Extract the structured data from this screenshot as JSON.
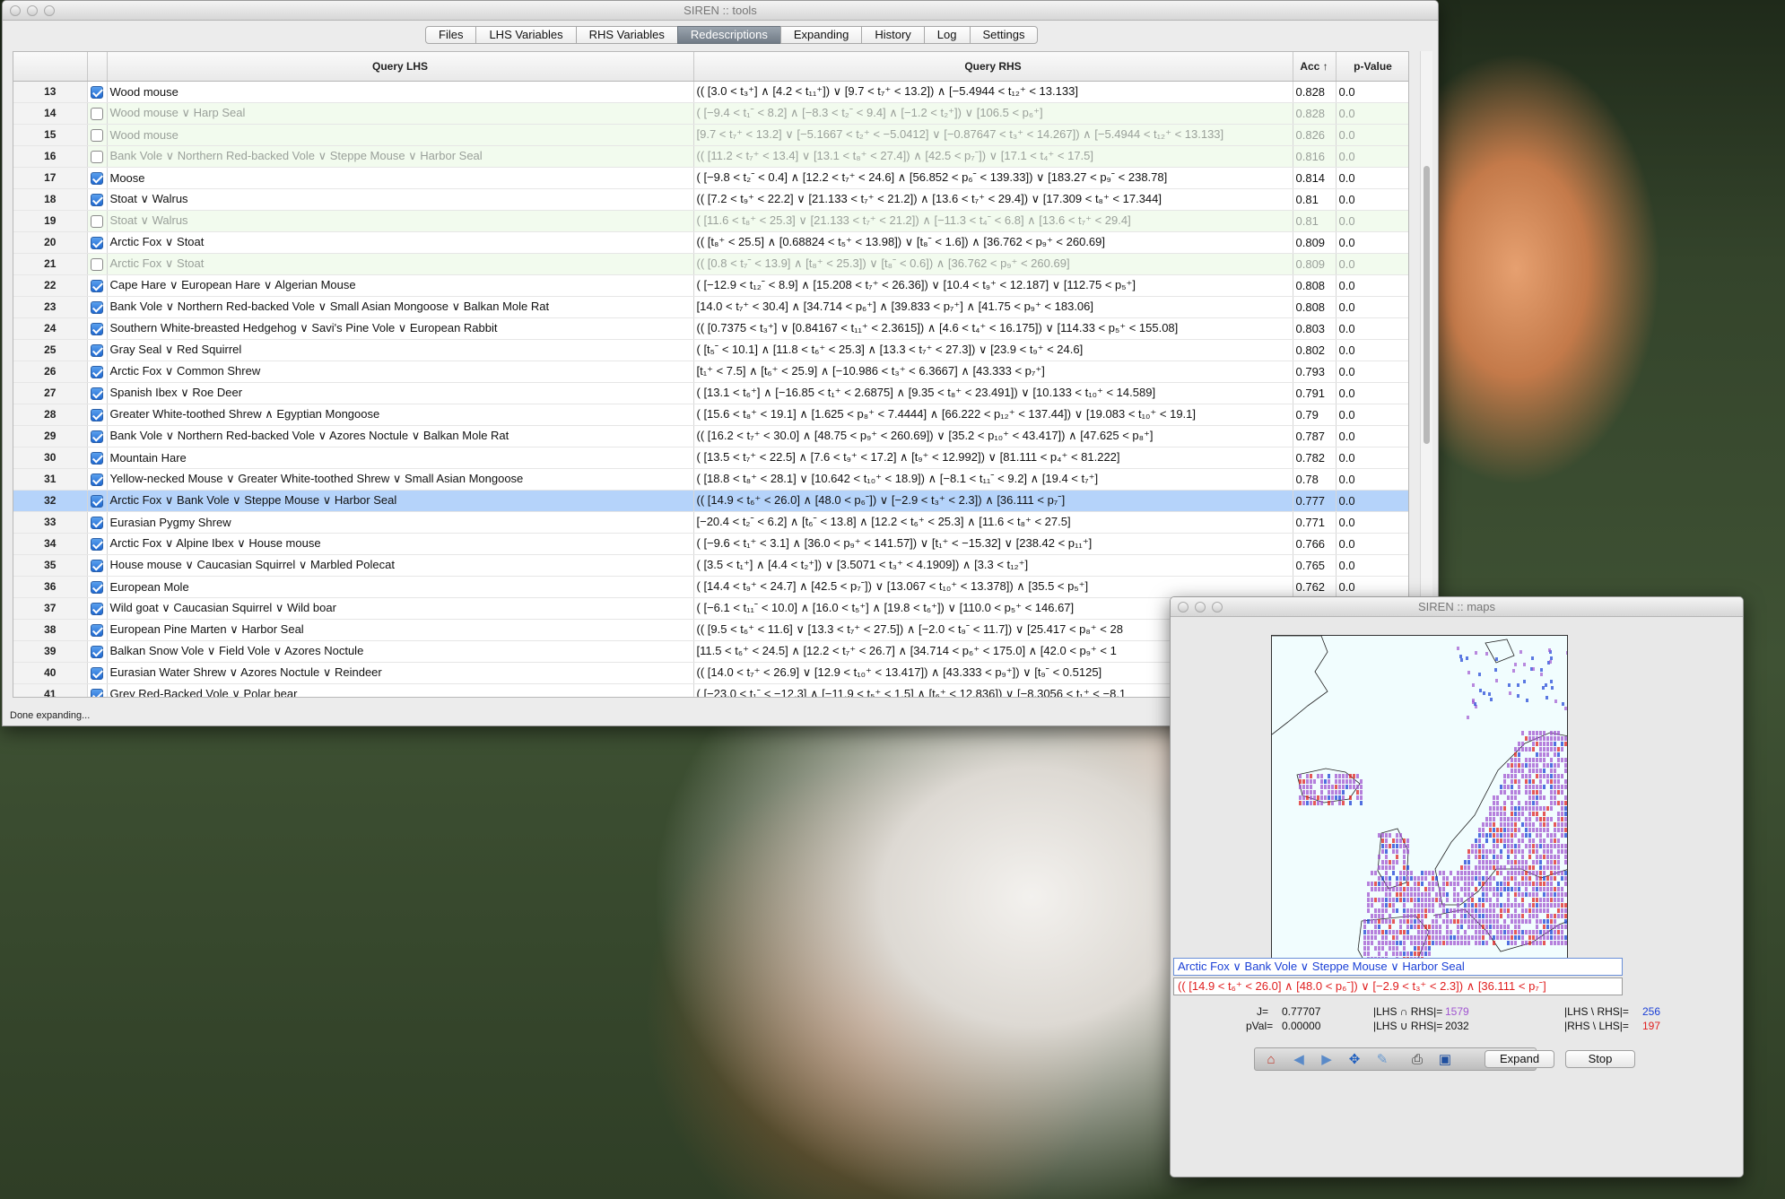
{
  "tools_window": {
    "title": "SIREN :: tools",
    "tabs": [
      {
        "label": "Files"
      },
      {
        "label": "LHS Variables"
      },
      {
        "label": "RHS Variables"
      },
      {
        "label": "Redescriptions",
        "selected": true
      },
      {
        "label": "Expanding"
      },
      {
        "label": "History"
      },
      {
        "label": "Log"
      },
      {
        "label": "Settings"
      }
    ],
    "columns": {
      "num": "",
      "check": "",
      "lhs": "Query LHS",
      "rhs": "Query RHS",
      "acc": "Acc ↑",
      "pval": "p-Value"
    },
    "rows": [
      {
        "n": "13",
        "on": true,
        "lhs": "Wood mouse",
        "rhs": "(( [3.0 < t₃⁺] ∧ [4.2 < t₁₁⁺]) ∨ [9.7 < t₇⁺ < 13.2]) ∧ [−5.4944 < t₁₂⁺ < 13.133]",
        "acc": "0.828",
        "p": "0.0"
      },
      {
        "n": "14",
        "on": false,
        "lhs": "Wood mouse ∨ Harp Seal",
        "rhs": "( [−9.4 < t₁ˉ < 8.2] ∧ [−8.3 < t₂ˉ < 9.4] ∧ [−1.2 < t₂⁺]) ∨ [106.5 < p₆⁺]",
        "acc": "0.828",
        "p": "0.0"
      },
      {
        "n": "15",
        "on": false,
        "lhs": "Wood mouse",
        "rhs": "[9.7 < t₇⁺ < 13.2] ∨ [−5.1667 < t₂⁺ < −5.0412] ∨ [−0.87647 < t₃⁺ < 14.267]) ∧ [−5.4944 < t₁₂⁺ < 13.133]",
        "acc": "0.826",
        "p": "0.0"
      },
      {
        "n": "16",
        "on": false,
        "lhs": "Bank Vole ∨ Northern Red-backed Vole ∨ Steppe Mouse ∨ Harbor Seal",
        "rhs": "(( [11.2 < t₇⁺ < 13.4] ∨ [13.1 < t₈⁺ < 27.4]) ∧ [42.5 < p₇ˉ]) ∨ [17.1 < t₄⁺ < 17.5]",
        "acc": "0.816",
        "p": "0.0"
      },
      {
        "n": "17",
        "on": true,
        "lhs": "Moose",
        "rhs": "( [−9.8 < t₂ˉ < 0.4] ∧ [12.2 < t₇⁺ < 24.6] ∧ [56.852 < p₆ˉ < 139.33]) ∨ [183.27 < p₉ˉ < 238.78]",
        "acc": "0.814",
        "p": "0.0"
      },
      {
        "n": "18",
        "on": true,
        "lhs": "Stoat ∨ Walrus",
        "rhs": "(( [7.2 < t₉⁺ < 22.2] ∨ [21.133 < t₇⁺ < 21.2]) ∧ [13.6 < t₇⁺ < 29.4]) ∨ [17.309 < t₈⁺ < 17.344]",
        "acc": "0.81",
        "p": "0.0"
      },
      {
        "n": "19",
        "on": false,
        "lhs": "Stoat ∨ Walrus",
        "rhs": "( [11.6 < t₈⁺ < 25.3] ∨ [21.133 < t₇⁺ < 21.2]) ∧ [−11.3 < t₄ˉ < 6.8] ∧ [13.6 < t₇⁺ < 29.4]",
        "acc": "0.81",
        "p": "0.0"
      },
      {
        "n": "20",
        "on": true,
        "lhs": "Arctic Fox ∨ Stoat",
        "rhs": "(( [t₈⁺ < 25.5] ∧ [0.68824 < t₅⁺ < 13.98]) ∨ [t₈ˉ < 1.6]) ∧ [36.762 < p₉⁺ < 260.69]",
        "acc": "0.809",
        "p": "0.0"
      },
      {
        "n": "21",
        "on": false,
        "lhs": "Arctic Fox ∨ Stoat",
        "rhs": "(( [0.8 < t₇ˉ < 13.9] ∧ [t₈⁺ < 25.3]) ∨ [t₈ˉ < 0.6]) ∧ [36.762 < p₉⁺ < 260.69]",
        "acc": "0.809",
        "p": "0.0"
      },
      {
        "n": "22",
        "on": true,
        "lhs": "Cape Hare ∨ European Hare ∨ Algerian Mouse",
        "rhs": "( [−12.9 < t₁₂ˉ < 8.9] ∧ [15.208 < t₇⁺ < 26.36]) ∨ [10.4 < t₉⁺ < 12.187] ∨ [112.75 < p₅⁺]",
        "acc": "0.808",
        "p": "0.0"
      },
      {
        "n": "23",
        "on": true,
        "lhs": "Bank Vole ∨ Northern Red-backed Vole ∨ Small Asian Mongoose ∨ Balkan Mole Rat",
        "rhs": "[14.0 < t₇⁺ < 30.4] ∧ [34.714 < p₆⁺] ∧ [39.833 < p₇⁺] ∧ [41.75 < p₉⁺ < 183.06]",
        "acc": "0.808",
        "p": "0.0"
      },
      {
        "n": "24",
        "on": true,
        "lhs": "Southern White-breasted Hedgehog ∨ Savi's Pine Vole ∨ European Rabbit",
        "rhs": "(( [0.7375 < t₃⁺] ∨ [0.84167 < t₁₁⁺ < 2.3615]) ∧ [4.6 < t₄⁺ < 16.175]) ∨ [114.33 < p₅⁺ < 155.08]",
        "acc": "0.803",
        "p": "0.0"
      },
      {
        "n": "25",
        "on": true,
        "lhs": "Gray Seal ∨ Red Squirrel",
        "rhs": "( [t₅ˉ < 10.1] ∧ [11.8 < t₆⁺ < 25.3] ∧ [13.3 < t₇⁺ < 27.3]) ∨ [23.9 < t₉⁺ < 24.6]",
        "acc": "0.802",
        "p": "0.0"
      },
      {
        "n": "26",
        "on": true,
        "lhs": "Arctic Fox ∨ Common Shrew",
        "rhs": "[t₁⁺ < 7.5] ∧ [t₆⁺ < 25.9] ∧ [−10.986 < t₃⁺ < 6.3667] ∧ [43.333 < p₇⁺]",
        "acc": "0.793",
        "p": "0.0"
      },
      {
        "n": "27",
        "on": true,
        "lhs": "Spanish Ibex ∨ Roe Deer",
        "rhs": "( [13.1 < t₆⁺] ∧ [−16.85 < t₁⁺ < 2.6875] ∧ [9.35 < t₈⁺ < 23.491]) ∨ [10.133 < t₁₀⁺ < 14.589]",
        "acc": "0.791",
        "p": "0.0"
      },
      {
        "n": "28",
        "on": true,
        "lhs": "Greater White-toothed Shrew ∧ Egyptian Mongoose",
        "rhs": "( [15.6 < t₈⁺ < 19.1] ∧ [1.625 < p₈⁺ < 7.4444] ∧ [66.222 < p₁₂⁺ < 137.44]) ∨ [19.083 < t₁₀⁺ < 19.1]",
        "acc": "0.79",
        "p": "0.0"
      },
      {
        "n": "29",
        "on": true,
        "lhs": "Bank Vole ∨ Northern Red-backed Vole ∨ Azores Noctule ∨ Balkan Mole Rat",
        "rhs": "(( [16.2 < t₇⁺ < 30.0] ∧ [48.75 < p₉⁺ < 260.69]) ∨ [35.2 < p₁₀⁺ < 43.417]) ∧ [47.625 < p₈⁺]",
        "acc": "0.787",
        "p": "0.0"
      },
      {
        "n": "30",
        "on": true,
        "lhs": "Mountain Hare",
        "rhs": "( [13.5 < t₇⁺ < 22.5] ∧ [7.6 < t₉⁺ < 17.2] ∧ [t₉⁺ < 12.992]) ∨ [81.111 < p₄⁺ < 81.222]",
        "acc": "0.782",
        "p": "0.0"
      },
      {
        "n": "31",
        "on": true,
        "lhs": "Yellow-necked Mouse ∨ Greater White-toothed Shrew ∨ Small Asian Mongoose",
        "rhs": "( [18.8 < t₈⁺ < 28.1] ∨ [10.642 < t₁₀⁺ < 18.9]) ∧ [−8.1 < t₁₁ˉ < 9.2] ∧ [19.4 < t₇⁺]",
        "acc": "0.78",
        "p": "0.0"
      },
      {
        "n": "32",
        "on": true,
        "sel": true,
        "lhs": "Arctic Fox ∨ Bank Vole ∨ Steppe Mouse ∨ Harbor Seal",
        "rhs": "(( [14.9 < t₆⁺ < 26.0] ∧ [48.0 < p₆ˉ]) ∨ [−2.9 < t₃⁺ < 2.3]) ∧ [36.111 < p₇ˉ]",
        "acc": "0.777",
        "p": "0.0"
      },
      {
        "n": "33",
        "on": true,
        "lhs": "Eurasian Pygmy Shrew",
        "rhs": "[−20.4 < t₂ˉ < 6.2] ∧ [t₆ˉ < 13.8] ∧ [12.2 < t₆⁺ < 25.3] ∧ [11.6 < t₈⁺ < 27.5]",
        "acc": "0.771",
        "p": "0.0"
      },
      {
        "n": "34",
        "on": true,
        "lhs": "Arctic Fox ∨ Alpine Ibex ∨ House mouse",
        "rhs": "( [−9.6 < t₁⁺ < 3.1] ∧ [36.0 < p₉⁺ < 141.57]) ∨ [t₁⁺ < −15.32] ∨ [238.42 < p₁₁⁺]",
        "acc": "0.766",
        "p": "0.0"
      },
      {
        "n": "35",
        "on": true,
        "lhs": "House mouse ∨ Caucasian Squirrel ∨ Marbled Polecat",
        "rhs": "( [3.5 < t₁⁺] ∧ [4.4 < t₂⁺]) ∨ [3.5071 < t₃⁺ < 4.1909]) ∧ [3.3 < t₁₂⁺]",
        "acc": "0.765",
        "p": "0.0"
      },
      {
        "n": "36",
        "on": true,
        "lhs": "European Mole",
        "rhs": "( [14.4 < t₉⁺ < 24.7] ∧ [42.5 < p₇ˉ]) ∨ [13.067 < t₁₀⁺ < 13.378]) ∧ [35.5 < p₅⁺]",
        "acc": "0.762",
        "p": "0.0"
      },
      {
        "n": "37",
        "on": true,
        "lhs": "Wild goat ∨ Caucasian Squirrel ∨ Wild boar",
        "rhs": "( [−6.1 < t₁₁ˉ < 10.0] ∧ [16.0 < t₅⁺] ∧ [19.8 < t₆⁺]) ∨ [110.0 < p₅⁺ < 146.67]",
        "acc": "0.762",
        "p": "0.0"
      },
      {
        "n": "38",
        "on": true,
        "lhs": "European Pine Marten ∨ Harbor Seal",
        "rhs": "(( [9.5 < t₆⁺ < 11.6] ∨ [13.3 < t₇⁺ < 27.5]) ∧ [−2.0 < t₉ˉ < 11.7]) ∨ [25.417 < p₈⁺ < 28",
        "acc": "",
        "p": ""
      },
      {
        "n": "39",
        "on": true,
        "lhs": "Balkan Snow Vole ∨ Field Vole ∨ Azores Noctule",
        "rhs": "[11.5 < t₆⁺ < 24.5] ∧ [12.2 < t₇⁺ < 26.7] ∧ [34.714 < p₆⁺ < 175.0] ∧ [42.0 < p₉⁺ < 1",
        "acc": "",
        "p": ""
      },
      {
        "n": "40",
        "on": true,
        "lhs": "Eurasian Water Shrew ∨ Azores Noctule ∨ Reindeer",
        "rhs": "(( [14.0 < t₇⁺ < 26.9] ∨ [12.9 < t₁₀⁺ < 13.417]) ∧ [43.333 < p₉⁺]) ∨ [t₉ˉ < 0.5125]",
        "acc": "",
        "p": ""
      },
      {
        "n": "41",
        "on": true,
        "lhs": "Grey Red-Backed Vole ∨ Polar bear",
        "rhs": "( [−23.0 < t₁ˉ < −12.3] ∧ [−11.9 < t₅⁺ < 1.5] ∧ [t₆⁺ < 12.836]) ∨ [−8.3056 < t₁⁺ < −8.1",
        "acc": "",
        "p": ""
      }
    ],
    "status": "Done expanding..."
  },
  "maps_window": {
    "title": "SIREN :: maps",
    "lhs_query": "Arctic Fox ∨ Bank Vole ∨ Steppe Mouse ∨ Harbor Seal",
    "rhs_query": "(( [14.9 < t₆⁺ < 26.0] ∧ [48.0 < p₆ˉ]) ∨ [−2.9 < t₃⁺ < 2.3]) ∧ [36.111 < p₇ˉ]",
    "stats": {
      "j_label": "J=",
      "j_value": "0.77707",
      "pval_label": "pVal=",
      "pval_value": "0.00000",
      "inter_label": "|LHS ∩ RHS|=",
      "inter_value": "1579",
      "union_label": "|LHS ∪ RHS|=",
      "union_value": "2032",
      "lhs_only_label": "|LHS \\ RHS|=",
      "lhs_only_value": "256",
      "rhs_only_label": "|RHS \\ LHS|=",
      "rhs_only_value": "197"
    },
    "toolbar_icons": [
      "home-icon",
      "back-icon",
      "forward-icon",
      "pan-icon",
      "configure-icon",
      "print-icon",
      "save-icon"
    ],
    "buttons": {
      "expand": "Expand",
      "stop": "Stop"
    },
    "colors": {
      "lhs": "#1a3fd6",
      "rhs": "#e02020",
      "both": "#a055d0",
      "stats_inter": "#a055d0",
      "stats_lhs": "#1a3fd6",
      "stats_rhs": "#e02020"
    }
  }
}
